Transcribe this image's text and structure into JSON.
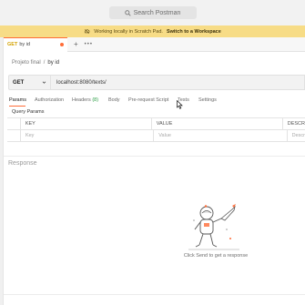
{
  "search": {
    "placeholder": "Search Postman",
    "icon": "search-icon"
  },
  "banner": {
    "text": "Working locally in Scratch Pad.",
    "link": "Switch to a Workspace",
    "color": "#f7dc86"
  },
  "tabs": [
    {
      "method": "GET",
      "label": "by id",
      "unsaved": true
    }
  ],
  "tab_actions": {
    "add": "+",
    "more": "•••"
  },
  "breadcrumb": {
    "parent": "Projeto final",
    "separator": "/",
    "current": "by id"
  },
  "request": {
    "method": "GET",
    "url": "localhost:8080/texts/"
  },
  "request_tabs": {
    "params": "Params",
    "authorization": "Authorization",
    "headers": "Headers",
    "headers_count": "(8)",
    "body": "Body",
    "prerequest": "Pre-request Script",
    "tests": "Tests",
    "settings": "Settings"
  },
  "query_params": {
    "title": "Query Params",
    "columns": [
      "KEY",
      "VALUE",
      "DESCR"
    ],
    "placeholders": [
      "Key",
      "Value",
      "Descr"
    ]
  },
  "response": {
    "label": "Response",
    "empty_message": "Click Send to get a response"
  },
  "colors": {
    "accent": "#ff6c37",
    "method_get": "#d4a200"
  }
}
